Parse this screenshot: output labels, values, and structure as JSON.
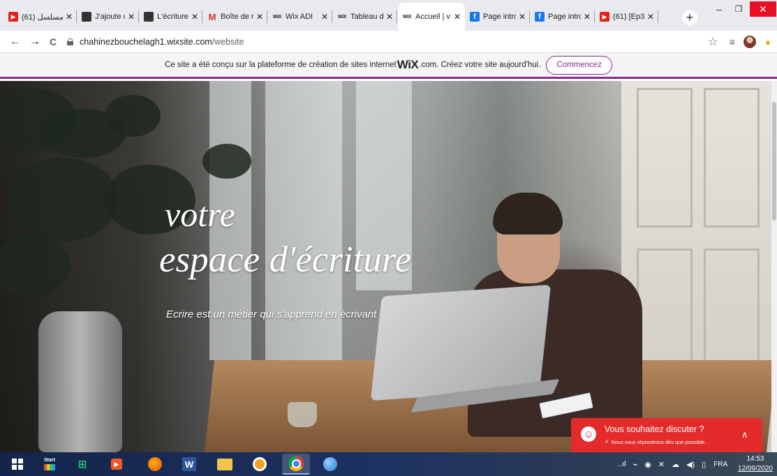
{
  "browser": {
    "tabs": [
      {
        "icon": "youtube-icon",
        "label": "مسلسل (61)",
        "active": false
      },
      {
        "icon": "chrome-icon",
        "label": "J'ajoute u",
        "active": false
      },
      {
        "icon": "chrome-icon",
        "label": "L'écriture",
        "active": false
      },
      {
        "icon": "gmail-icon",
        "label": "Boîte de r",
        "active": false
      },
      {
        "icon": "wix-icon",
        "label": "Wix ADI",
        "active": false
      },
      {
        "icon": "wix-icon",
        "label": "Tableau d",
        "active": false
      },
      {
        "icon": "wix-icon",
        "label": "Accueil | v",
        "active": true
      },
      {
        "icon": "facebook-icon",
        "label": "Page intro",
        "active": false
      },
      {
        "icon": "facebook-icon",
        "label": "Page intro",
        "active": false
      },
      {
        "icon": "youtube-icon",
        "label": "(61) [Ep3",
        "active": false
      }
    ],
    "tab_close": "✕",
    "new_tab": "+",
    "minimize": "–",
    "maximize": "❐",
    "close": "✕",
    "url_host": "chahinezbouchelagh1.wixsite.com",
    "url_path": "/website",
    "back": "←",
    "forward": "→",
    "reload": "C",
    "bookmark_star": "☆",
    "reading_list": "≡",
    "extension": "●"
  },
  "wix_banner": {
    "text_before": "Ce site a été conçu sur la plateforme de création de sites internet ",
    "logo": "WiX",
    "text_after": ".com. Créez votre site aujourd'hui.",
    "cta": "Commencez",
    "accent_color": "#8a2c8f"
  },
  "hero": {
    "title_line1": "votre",
    "title_line2": "espace d'écriture",
    "tagline": "Ecrire est un métier qui s'apprend en écrivant"
  },
  "chat": {
    "title": "Vous souhaitez discuter ?",
    "subtitle": "Nous vous répondrons dès que possible.",
    "bolt": "⚡",
    "toggle": "∧",
    "face": "☺",
    "color": "#e32b2b"
  },
  "taskbar": {
    "menu_label": "Start",
    "word_letter": "W",
    "store_glyph": "⊞",
    "media_glyph": "▶",
    "tray_icons": [
      "signal-icon",
      "usb-icon",
      "security-icon",
      "antivirus-icon",
      "cloud-icon",
      "volume-icon",
      "battery-icon"
    ],
    "tray_glyphs": [
      "..ıl",
      "⌁",
      "◉",
      "✕",
      "☁",
      "◀)",
      "▯"
    ],
    "language": "FRA",
    "time": "14:53",
    "date": "12/09/2020"
  }
}
